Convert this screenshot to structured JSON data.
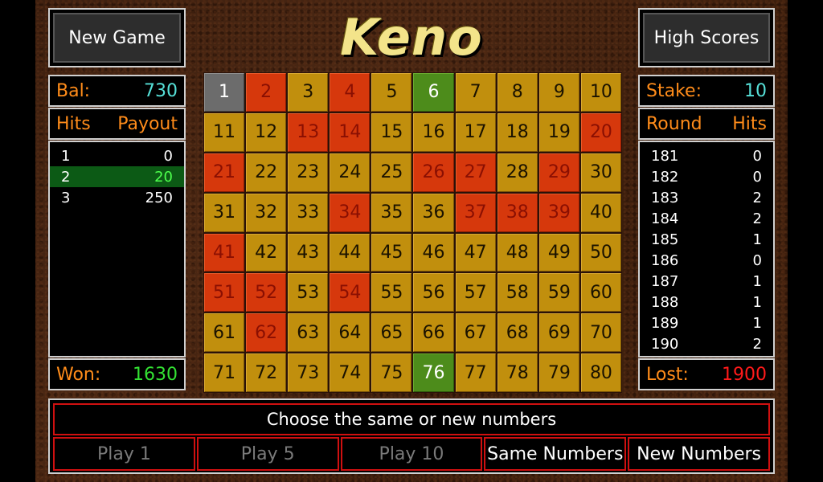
{
  "title": "Keno",
  "buttons": {
    "new_game": "New Game",
    "high_scores": "High Scores"
  },
  "left": {
    "balance_label": "Bal:",
    "balance_value": "730",
    "hits_header": "Hits",
    "payout_header": "Payout",
    "payouts": [
      {
        "hits": "1",
        "payout": "0"
      },
      {
        "hits": "2",
        "payout": "20"
      },
      {
        "hits": "3",
        "payout": "250"
      }
    ],
    "won_label": "Won:",
    "won_value": "1630"
  },
  "right": {
    "stake_label": "Stake:",
    "stake_value": "10",
    "round_header": "Round",
    "hits_header": "Hits",
    "rounds": [
      {
        "round": "181",
        "hits": "0"
      },
      {
        "round": "182",
        "hits": "0"
      },
      {
        "round": "183",
        "hits": "2"
      },
      {
        "round": "184",
        "hits": "2"
      },
      {
        "round": "185",
        "hits": "1"
      },
      {
        "round": "186",
        "hits": "0"
      },
      {
        "round": "187",
        "hits": "1"
      },
      {
        "round": "188",
        "hits": "1"
      },
      {
        "round": "189",
        "hits": "1"
      },
      {
        "round": "190",
        "hits": "2"
      }
    ],
    "lost_label": "Lost:",
    "lost_value": "1900"
  },
  "board": {
    "numbers": [
      "1",
      "2",
      "3",
      "4",
      "5",
      "6",
      "7",
      "8",
      "9",
      "10",
      "11",
      "12",
      "13",
      "14",
      "15",
      "16",
      "17",
      "18",
      "19",
      "20",
      "21",
      "22",
      "23",
      "24",
      "25",
      "26",
      "27",
      "28",
      "29",
      "30",
      "31",
      "32",
      "33",
      "34",
      "35",
      "36",
      "37",
      "38",
      "39",
      "40",
      "41",
      "42",
      "43",
      "44",
      "45",
      "46",
      "47",
      "48",
      "49",
      "50",
      "51",
      "52",
      "53",
      "54",
      "55",
      "56",
      "57",
      "58",
      "59",
      "60",
      "61",
      "62",
      "63",
      "64",
      "65",
      "66",
      "67",
      "68",
      "69",
      "70",
      "71",
      "72",
      "73",
      "74",
      "75",
      "76",
      "77",
      "78",
      "79",
      "80"
    ],
    "picked": [
      2,
      4,
      13,
      14,
      20,
      21,
      26,
      27,
      29,
      34,
      37,
      38,
      39,
      41,
      51,
      52,
      54,
      62
    ],
    "hits": [
      6,
      76
    ],
    "drawn": [
      1
    ],
    "colors": {
      "normal": "#c18f0d",
      "picked": "#d6380c",
      "hit": "#4d8c1b",
      "drawn": "#6c6c6c"
    }
  },
  "message": "Choose the same or new numbers",
  "actions": [
    {
      "label": "Play 1",
      "enabled": false
    },
    {
      "label": "Play 5",
      "enabled": false
    },
    {
      "label": "Play 10",
      "enabled": false
    },
    {
      "label": "Same Numbers",
      "enabled": true
    },
    {
      "label": "New Numbers",
      "enabled": true
    }
  ]
}
